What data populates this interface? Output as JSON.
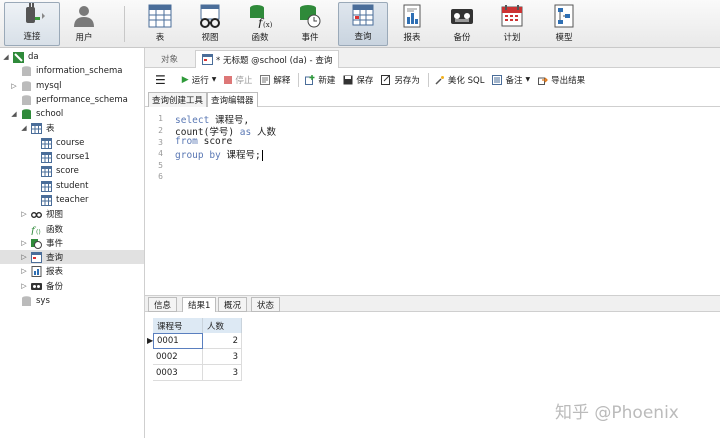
{
  "toolbar": {
    "items": [
      {
        "label": "连接",
        "icon": "connect-icon"
      },
      {
        "label": "用户",
        "icon": "user-icon"
      },
      {
        "label": "表",
        "icon": "table-icon"
      },
      {
        "label": "视图",
        "icon": "view-icon"
      },
      {
        "label": "函数",
        "icon": "function-icon"
      },
      {
        "label": "事件",
        "icon": "event-icon"
      },
      {
        "label": "查询",
        "icon": "query-icon"
      },
      {
        "label": "报表",
        "icon": "report-icon"
      },
      {
        "label": "备份",
        "icon": "backup-icon"
      },
      {
        "label": "计划",
        "icon": "schedule-icon"
      },
      {
        "label": "模型",
        "icon": "model-icon"
      }
    ],
    "active": "查询"
  },
  "sidebar": {
    "connection": "da",
    "databases": [
      "information_schema",
      "mysql",
      "performance_schema",
      "school",
      "sys"
    ],
    "school": {
      "tables_label": "表",
      "tables": [
        "course",
        "course1",
        "score",
        "student",
        "teacher"
      ],
      "views_label": "视图",
      "functions_label": "函数",
      "events_label": "事件",
      "queries_label": "查询",
      "reports_label": "报表",
      "backups_label": "备份"
    }
  },
  "tabs": {
    "objects": "对象",
    "query_tab": "* 无标题 @school (da) - 查询"
  },
  "query_toolbar": {
    "run": "运行",
    "stop": "停止",
    "explain": "解释",
    "new": "新建",
    "save": "保存",
    "save_as": "另存为",
    "beautify": "美化 SQL",
    "comment": "备注",
    "export": "导出结果"
  },
  "subtabs": {
    "builder": "查询创建工具",
    "editor": "查询编辑器"
  },
  "editor": {
    "line_numbers": [
      "1",
      "2",
      "3",
      "4",
      "5",
      "6"
    ],
    "lines": [
      {
        "kw": "select",
        "rest": " 课程号,"
      },
      {
        "kw": "",
        "rest": "count(学号) ",
        "kw2": "as",
        "rest2": " 人数"
      },
      {
        "kw": "from",
        "rest": " score"
      },
      {
        "kw": "group by",
        "rest": " 课程号;"
      }
    ]
  },
  "result_tabs": {
    "info": "信息",
    "result1": "结果1",
    "overview": "概况",
    "status": "状态"
  },
  "result": {
    "columns": [
      "课程号",
      "人数"
    ],
    "rows": [
      [
        "0001",
        "2"
      ],
      [
        "0002",
        "3"
      ],
      [
        "0003",
        "3"
      ]
    ]
  },
  "watermark": "知乎 @Phoenix"
}
